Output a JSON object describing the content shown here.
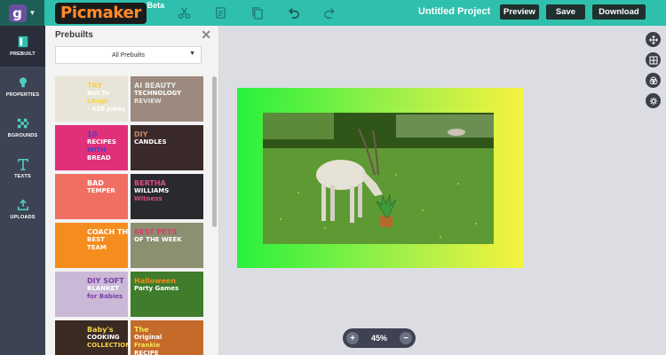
{
  "header": {
    "app_icon_letter": "g",
    "logo_text": "Picmaker",
    "logo_badge": "Beta",
    "project_title": "Untitled Project",
    "preview_label": "Preview",
    "save_label": "Save",
    "download_label": "Download",
    "tools": [
      "scissors-icon",
      "copy-icon",
      "duplicate-icon",
      "undo-icon",
      "redo-icon"
    ]
  },
  "sidebar": {
    "items": [
      {
        "label": "PREBUILT",
        "icon": "prebuilt-icon"
      },
      {
        "label": "PROPERTIES",
        "icon": "bulb-icon"
      },
      {
        "label": "BGROUNDS",
        "icon": "checker-icon"
      },
      {
        "label": "TEXTS",
        "icon": "text-icon"
      },
      {
        "label": "UPLOADS",
        "icon": "upload-icon"
      }
    ]
  },
  "panel": {
    "title": "Prebuilts",
    "dropdown_value": "All Prebuilts",
    "thumbs": [
      {
        "lines": [
          "TRY",
          "Not To",
          "Laugh",
          "- 420 Jokes"
        ],
        "bg": "#e8e4d8",
        "accent": "#f4d34a"
      },
      {
        "lines": [
          "AI BEAUTY",
          "TECHNOLOGY",
          "REVIEW"
        ],
        "bg": "#9c8a7e",
        "accent": "#e6e6e6"
      },
      {
        "lines": [
          "10",
          "RECIPES",
          "WITH",
          "BREAD"
        ],
        "bg": "#e0307a",
        "accent": "#4a3fc4"
      },
      {
        "lines": [
          "DIY",
          "CANDLES"
        ],
        "bg": "#3a2a2a",
        "accent": "#c48860"
      },
      {
        "lines": [
          "BAD",
          "TEMPER"
        ],
        "bg": "#f06e62",
        "accent": "#ffffff"
      },
      {
        "lines": [
          "BERTHA",
          "WILLIAMS",
          "Witness"
        ],
        "bg": "#2a2a2e",
        "accent": "#e04a8a"
      },
      {
        "lines": [
          "COACH THE",
          "BEST",
          "TEAM"
        ],
        "bg": "#f58c1e",
        "accent": "#ffffff"
      },
      {
        "lines": [
          "BEST PETS",
          "OF THE WEEK"
        ],
        "bg": "#8a9070",
        "accent": "#e03a6a"
      },
      {
        "lines": [
          "DIY SOFT",
          "BLANKET",
          "for Babies"
        ],
        "bg": "#c9b8d6",
        "accent": "#7a3ca8"
      },
      {
        "lines": [
          "Halloween",
          "Party Games"
        ],
        "bg": "#3f7c2c",
        "accent": "#f18a1e"
      },
      {
        "lines": [
          "Baby's",
          "COOKING",
          "COLLECTION"
        ],
        "bg": "#3a2a22",
        "accent": "#f3d24a"
      },
      {
        "lines": [
          "The",
          "Original",
          "Frankie",
          "RECIPE"
        ],
        "bg": "#c46a2a",
        "accent": "#f7e35a"
      }
    ]
  },
  "canvas": {
    "zoom": "45%",
    "zoom_in": "+",
    "zoom_out": "−",
    "right_tools": [
      "move-icon",
      "grid-icon",
      "layers-icon",
      "settings-icon"
    ]
  },
  "colors": {
    "topbar": "#2ec0ad",
    "sidebar": "#3e4354",
    "accent": "#ff8a2a"
  }
}
